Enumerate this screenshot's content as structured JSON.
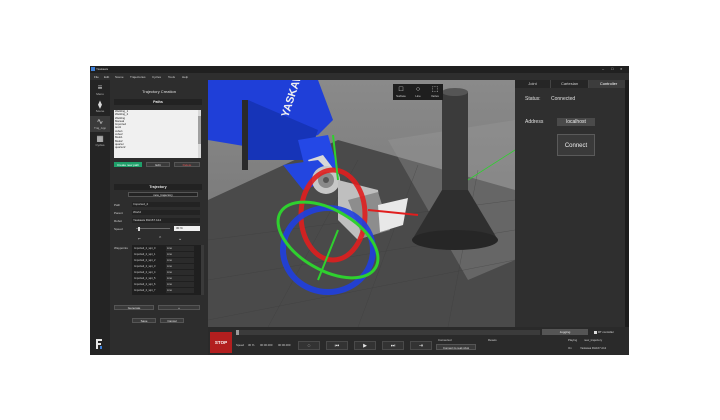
{
  "window": {
    "title": "Yaskawa",
    "controls": [
      "─",
      "☐",
      "✕"
    ]
  },
  "menu": [
    "File",
    "Edit",
    "Scene",
    "Trajectories",
    "Cycles",
    "Tools",
    "Help"
  ],
  "sidebar": [
    {
      "label": "Menu",
      "icon": "≡"
    },
    {
      "label": "Scene",
      "icon": "⧫"
    },
    {
      "label": "Traj_App",
      "icon": "∿"
    },
    {
      "label": "Cycles",
      "icon": "▦"
    }
  ],
  "left_panel": {
    "title": "Trajectory Creation",
    "paths_header": "Paths",
    "paths": [
      "Welding_1",
      "Welding_2",
      "Welding",
      "Manual",
      "Imported",
      "test1",
      "cube1",
      "cube2",
      "Melo1",
      "Melo2",
      "quarter",
      "quarter2"
    ],
    "buttons": {
      "create": "Create new path",
      "edit": "Edit",
      "delete": "Delete"
    },
    "trajectory_header": "Trajectory",
    "trajectory_name": "new_trajectory",
    "fields": [
      {
        "label": "Path",
        "value": "Imported_2"
      },
      {
        "label": "Parent",
        "value": "World"
      },
      {
        "label": "Robot",
        "value": "Yaskawa RH167 A12"
      }
    ],
    "speed": {
      "label": "Speed",
      "value": "30 %",
      "fraction": 0.05
    },
    "waypoint_icons": [
      "⌐",
      "⌃",
      "⌄"
    ],
    "waypoints_label": "Waypoints",
    "waypoints": [
      {
        "name": "Imported_2_wpt_0",
        "motion": "Line"
      },
      {
        "name": "Imported_2_wpt_1",
        "motion": "Line"
      },
      {
        "name": "Imported_2_wpt_2",
        "motion": "Line"
      },
      {
        "name": "Imported_2_wpt_3",
        "motion": "Line"
      },
      {
        "name": "Imported_2_wpt_4",
        "motion": "Line"
      },
      {
        "name": "Imported_2_wpt_5",
        "motion": "Line"
      },
      {
        "name": "Imported_2_wpt_6",
        "motion": "Line"
      },
      {
        "name": "Imported_2_wpt_7",
        "motion": "Line"
      }
    ],
    "generate": "Generate",
    "plus": "+",
    "save": "Save",
    "cancel": "Cancel"
  },
  "viewport": {
    "toolbar": [
      {
        "label": "Surface",
        "icon": "□"
      },
      {
        "label": "Line",
        "icon": "○"
      },
      {
        "label": "Vertex",
        "icon": "⬚"
      }
    ],
    "robot_text": "YASKAWA",
    "colors": {
      "robot": "#1f3fd8",
      "floor": "#4a4a4a",
      "gizmo_red": "#e01e1e",
      "gizmo_blue": "#1f3fe0",
      "gizmo_green": "#2fd02f"
    }
  },
  "right_panel": {
    "tabs": [
      "Joint",
      "Cartesian",
      "Controller"
    ],
    "active_tab": "Controller",
    "status_label": "Status:",
    "status_value": "Connected",
    "address_label": "Address",
    "address_value": "localhost",
    "connect": "Connect"
  },
  "bottom": {
    "stop": "STOP",
    "jogging": "Jogging",
    "controller_checkbox": "RT controller",
    "speed_label": "Speed",
    "speed_value": "30 %",
    "time_a": "00:00.000",
    "time_b": "00:00.000",
    "status": "Connected",
    "reset": "Resets",
    "connect_robot": "Connect to real robot",
    "playing_label": "Playing",
    "playing_value": "new_trajectory",
    "on_label": "On",
    "on_value": "Yaskawa RH167 A12"
  }
}
